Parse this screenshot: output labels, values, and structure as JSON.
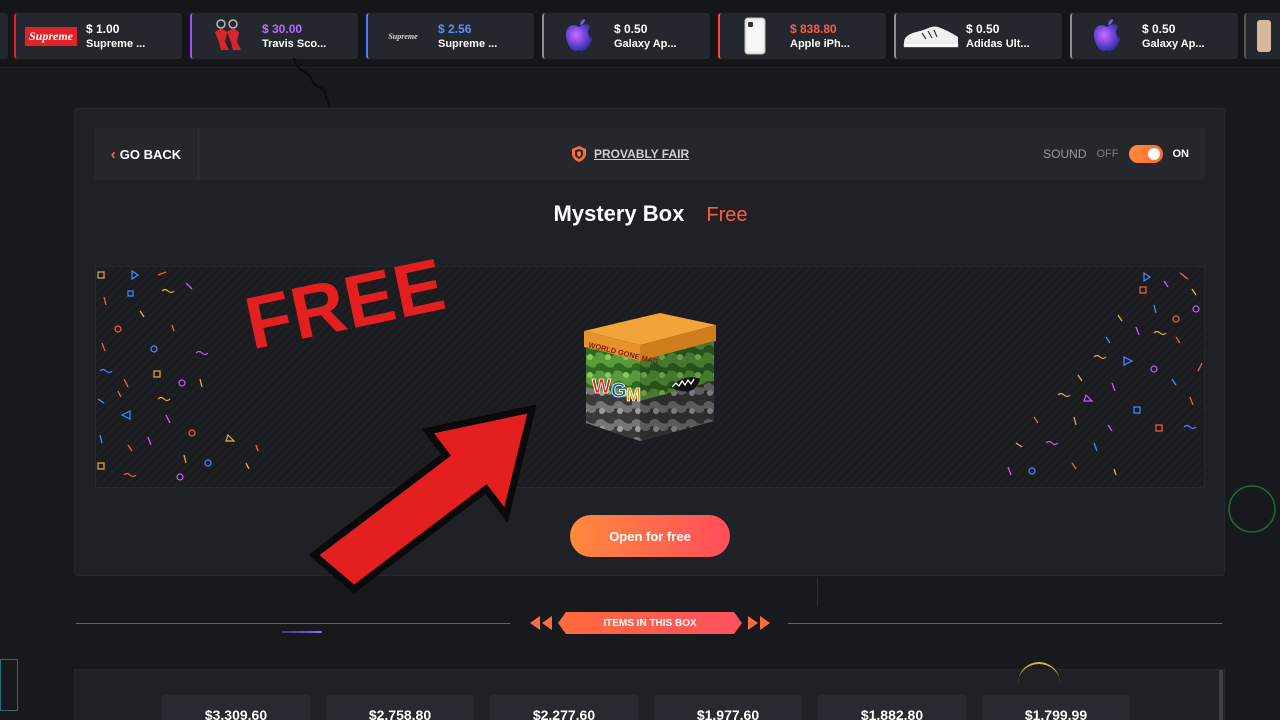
{
  "ticker": [
    {
      "price": "$ 1.00",
      "name": "Supreme ...",
      "thumb": "supreme",
      "price_color": "#ffffff",
      "accent": "#e32129"
    },
    {
      "price": "$ 30.00",
      "name": "Travis Sco...",
      "thumb": "keychain",
      "price_color": "#b36cff",
      "accent": "#a44dff"
    },
    {
      "price": "$ 2.56",
      "name": "Supreme ...",
      "thumb": "supreme-small",
      "price_color": "#5c8dff",
      "accent": "#4f7dff"
    },
    {
      "price": "$ 0.50",
      "name": "Galaxy Ap...",
      "thumb": "galaxy-apple",
      "price_color": "#ffffff",
      "accent": "#8a8d93"
    },
    {
      "price": "$ 838.80",
      "name": "Apple iPh...",
      "thumb": "iphone",
      "price_color": "#ff5b45",
      "accent": "#ff4a3a"
    },
    {
      "price": "$ 0.50",
      "name": "Adidas Ult...",
      "thumb": "sneaker",
      "price_color": "#ffffff",
      "accent": "#8a8d93"
    },
    {
      "price": "$ 0.50",
      "name": "Galaxy Ap...",
      "thumb": "galaxy-apple",
      "price_color": "#ffffff",
      "accent": "#8a8d93"
    }
  ],
  "topbar": {
    "back_label": "GO BACK",
    "provably_fair": "PROVABLY FAIR",
    "sound_label": "SOUND",
    "sound_off": "OFF",
    "sound_on": "ON"
  },
  "box": {
    "title": "Mystery Box",
    "price": "Free",
    "box_label_top": "WORLD GONE MAD",
    "box_letters": "WGM",
    "open_button": "Open for free"
  },
  "overlay": {
    "free_text": "FREE"
  },
  "section": {
    "items_label": "ITEMS IN THIS BOX"
  },
  "items": [
    {
      "price": "$3,309.60"
    },
    {
      "price": "$2,758.80"
    },
    {
      "price": "$2,277.60"
    },
    {
      "price": "$1,977.60"
    },
    {
      "price": "$1,882.80"
    },
    {
      "price": "$1,799.99"
    }
  ],
  "colors": {
    "accent": "#ff6b3d",
    "accent_red": "#ff4d5a",
    "free_red": "#e3201f"
  }
}
